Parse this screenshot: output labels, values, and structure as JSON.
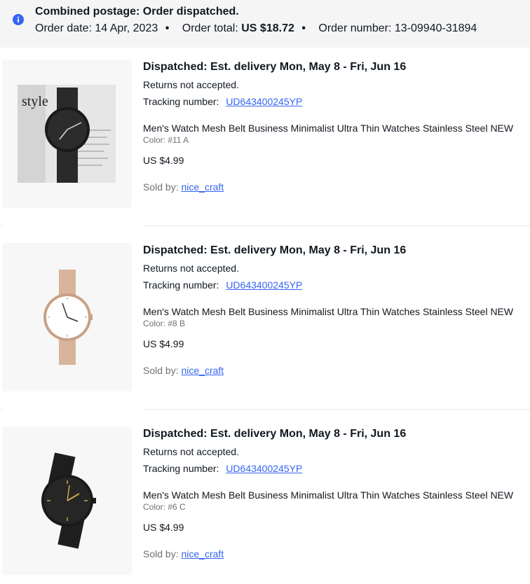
{
  "banner": {
    "title": "Combined postage: Order dispatched.",
    "order_date_label": "Order date:",
    "order_date": "14 Apr, 2023",
    "order_total_label": "Order total:",
    "order_total": "US $18.72",
    "order_number_label": "Order number:",
    "order_number": "13-09940-31894",
    "separator": "•",
    "icon": "info-icon"
  },
  "items": [
    {
      "status": "Dispatched: Est. delivery Mon, May 8 - Fri, Jun 16",
      "returns": "Returns not accepted.",
      "tracking_label": "Tracking number:",
      "tracking_number": "UD643400245YP",
      "title": "Men's Watch Mesh Belt Business Minimalist Ultra Thin Watches Stainless Steel NEW",
      "variant": "Color: #11 A",
      "price": "US $4.99",
      "seller_label": "Sold by:",
      "seller": "nice_craft",
      "image_text": "style"
    },
    {
      "status": "Dispatched: Est. delivery Mon, May 8 - Fri, Jun 16",
      "returns": "Returns not accepted.",
      "tracking_label": "Tracking number:",
      "tracking_number": "UD643400245YP",
      "title": "Men's Watch Mesh Belt Business Minimalist Ultra Thin Watches Stainless Steel NEW",
      "variant": "Color: #8 B",
      "price": "US $4.99",
      "seller_label": "Sold by:",
      "seller": "nice_craft"
    },
    {
      "status": "Dispatched: Est. delivery Mon, May 8 - Fri, Jun 16",
      "returns": "Returns not accepted.",
      "tracking_label": "Tracking number:",
      "tracking_number": "UD643400245YP",
      "title": "Men's Watch Mesh Belt Business Minimalist Ultra Thin Watches Stainless Steel NEW",
      "variant": "Color: #6 C",
      "price": "US $4.99",
      "seller_label": "Sold by:",
      "seller": "nice_craft"
    }
  ],
  "colors": {
    "link": "#3665f3",
    "banner_bg": "#f5f5f5",
    "info_icon": "#3665f3",
    "muted_text": "#707070"
  }
}
